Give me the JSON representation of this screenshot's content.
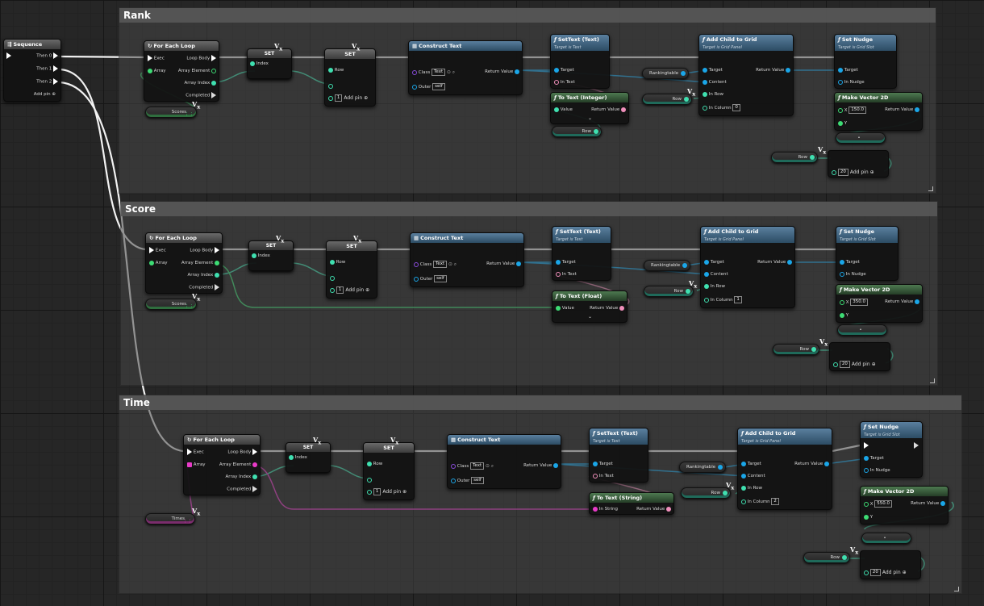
{
  "comments": [
    "Rank",
    "Score",
    "Time"
  ],
  "sequence": {
    "title": "Sequence",
    "pins": [
      "Then 0",
      "Then 1",
      "Then 2"
    ],
    "add_pin": "Add pin"
  },
  "for_each": {
    "title": "For Each Loop",
    "exec": "Exec",
    "array": "Array",
    "loop_body": "Loop Body",
    "array_element": "Array Element",
    "array_index": "Array Index",
    "completed": "Completed"
  },
  "set": {
    "title": "SET",
    "index": "Index",
    "row": "Row"
  },
  "add_pin": "Add pin",
  "construct_text": {
    "title": "Construct Text",
    "class": "Class",
    "class_value": "Text",
    "outer": "Outer",
    "outer_value": "self",
    "return": "Return Value"
  },
  "set_text": {
    "title": "SetText (Text)",
    "sub": "Target is Text",
    "target": "Target",
    "in_text": "In Text"
  },
  "add_child": {
    "title": "Add Child to Grid",
    "sub": "Target is Grid Panel",
    "target": "Target",
    "content": "Content",
    "in_row": "In Row",
    "in_column": "In Column",
    "return": "Return Value"
  },
  "set_nudge": {
    "title": "Set Nudge",
    "sub": "Target is Grid Slot",
    "target": "Target",
    "in_nudge": "In Nudge"
  },
  "make_vector": {
    "title": "Make Vector 2D",
    "x": "X",
    "y": "Y",
    "return": "Return Value"
  },
  "to_text": {
    "integer": "To Text (Integer)",
    "float": "To Text (Float)",
    "string": "To Text (String)",
    "value": "Value",
    "in_string": "In String",
    "return": "Return Value"
  },
  "vars": {
    "scores": "Scores",
    "times": "Times",
    "row": "Row",
    "rankingtable": "Rankingtable"
  },
  "sections": [
    {
      "array_var": "Scores",
      "to_text": "To Text (Integer)",
      "column": "0",
      "x_value": "150.0",
      "nudge_y": "20"
    },
    {
      "array_var": "Scores",
      "to_text": "To Text (Float)",
      "column": "1",
      "x_value": "350.0",
      "nudge_y": "20"
    },
    {
      "array_var": "Times",
      "to_text": "To Text (String)",
      "column": "2",
      "x_value": "550.0",
      "nudge_y": "20"
    }
  ],
  "set_index_value": "1",
  "icons": [
    "sequence-icon",
    "loop-icon",
    "function-icon",
    "variable-get-icon",
    "construct-icon",
    "search-icon",
    "resize-grip-icon"
  ]
}
